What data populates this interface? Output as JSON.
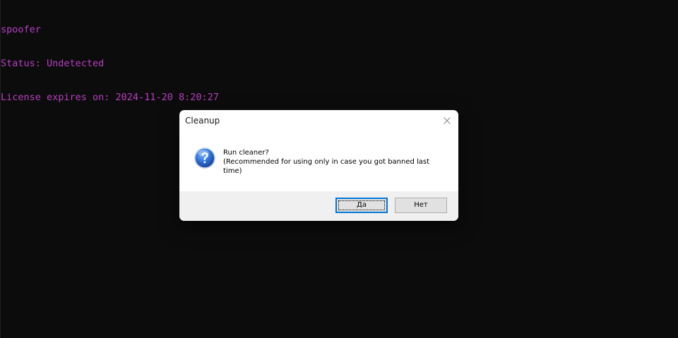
{
  "console": {
    "lines": [
      "spoofer",
      "Status: Undetected",
      "License expires on: 2024-11-20 8:20:27"
    ],
    "text_color": "#b93ec3",
    "background": "#0c0c0c"
  },
  "dialog": {
    "title": "Cleanup",
    "icon": "question-icon",
    "message_line1": "Run cleaner?",
    "message_line2": "(Recommended for using only in case you got banned last time)",
    "buttons": {
      "yes_label": "Да",
      "no_label": "Нет"
    },
    "accent": "#0078d7"
  }
}
